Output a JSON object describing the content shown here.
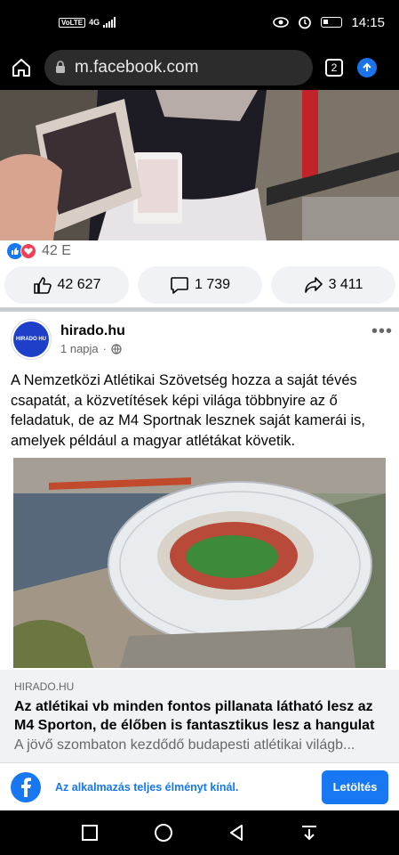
{
  "status_bar": {
    "network": "VoLTE",
    "signal_type": "4G",
    "time": "14:15",
    "icons": [
      "eye-icon",
      "alarm-icon",
      "battery-icon"
    ]
  },
  "browser": {
    "url": "m.facebook.com",
    "tab_count": "2",
    "icons": [
      "home-icon",
      "lock-icon",
      "upload-icon"
    ]
  },
  "previous_post": {
    "reaction_count": "42 E",
    "likes": "42 627",
    "comments": "1 739",
    "shares": "3 411"
  },
  "post": {
    "page_name": "hirado.hu",
    "avatar_text": "HIRADO HU",
    "time": "1 napja",
    "more_label": "•••",
    "text": "A Nemzetközi Atlétikai Szövetség hozza a saját tévés csapatát, a közvetítések képi világa többnyire az ő feladatuk, de az M4 Sportnak lesznek saját kamerái is, amelyek például a magyar atlétákat követik."
  },
  "link_preview": {
    "domain": "HIRADO.HU",
    "title": "Az atlétikai vb minden fontos pillanata látható lesz az M4 Sporton, de élőben is fantasztikus lesz a hangulat",
    "description": "A jövő szombaton kezdődő budapesti atlétikai világb..."
  },
  "app_banner": {
    "text": "Az alkalmazás teljes élményt kínál.",
    "button_label": "Letöltés"
  },
  "colors": {
    "facebook_blue": "#1877f2",
    "love_red": "#f33e58",
    "grey_bg": "#f0f2f5",
    "secondary_text": "#65676b"
  }
}
